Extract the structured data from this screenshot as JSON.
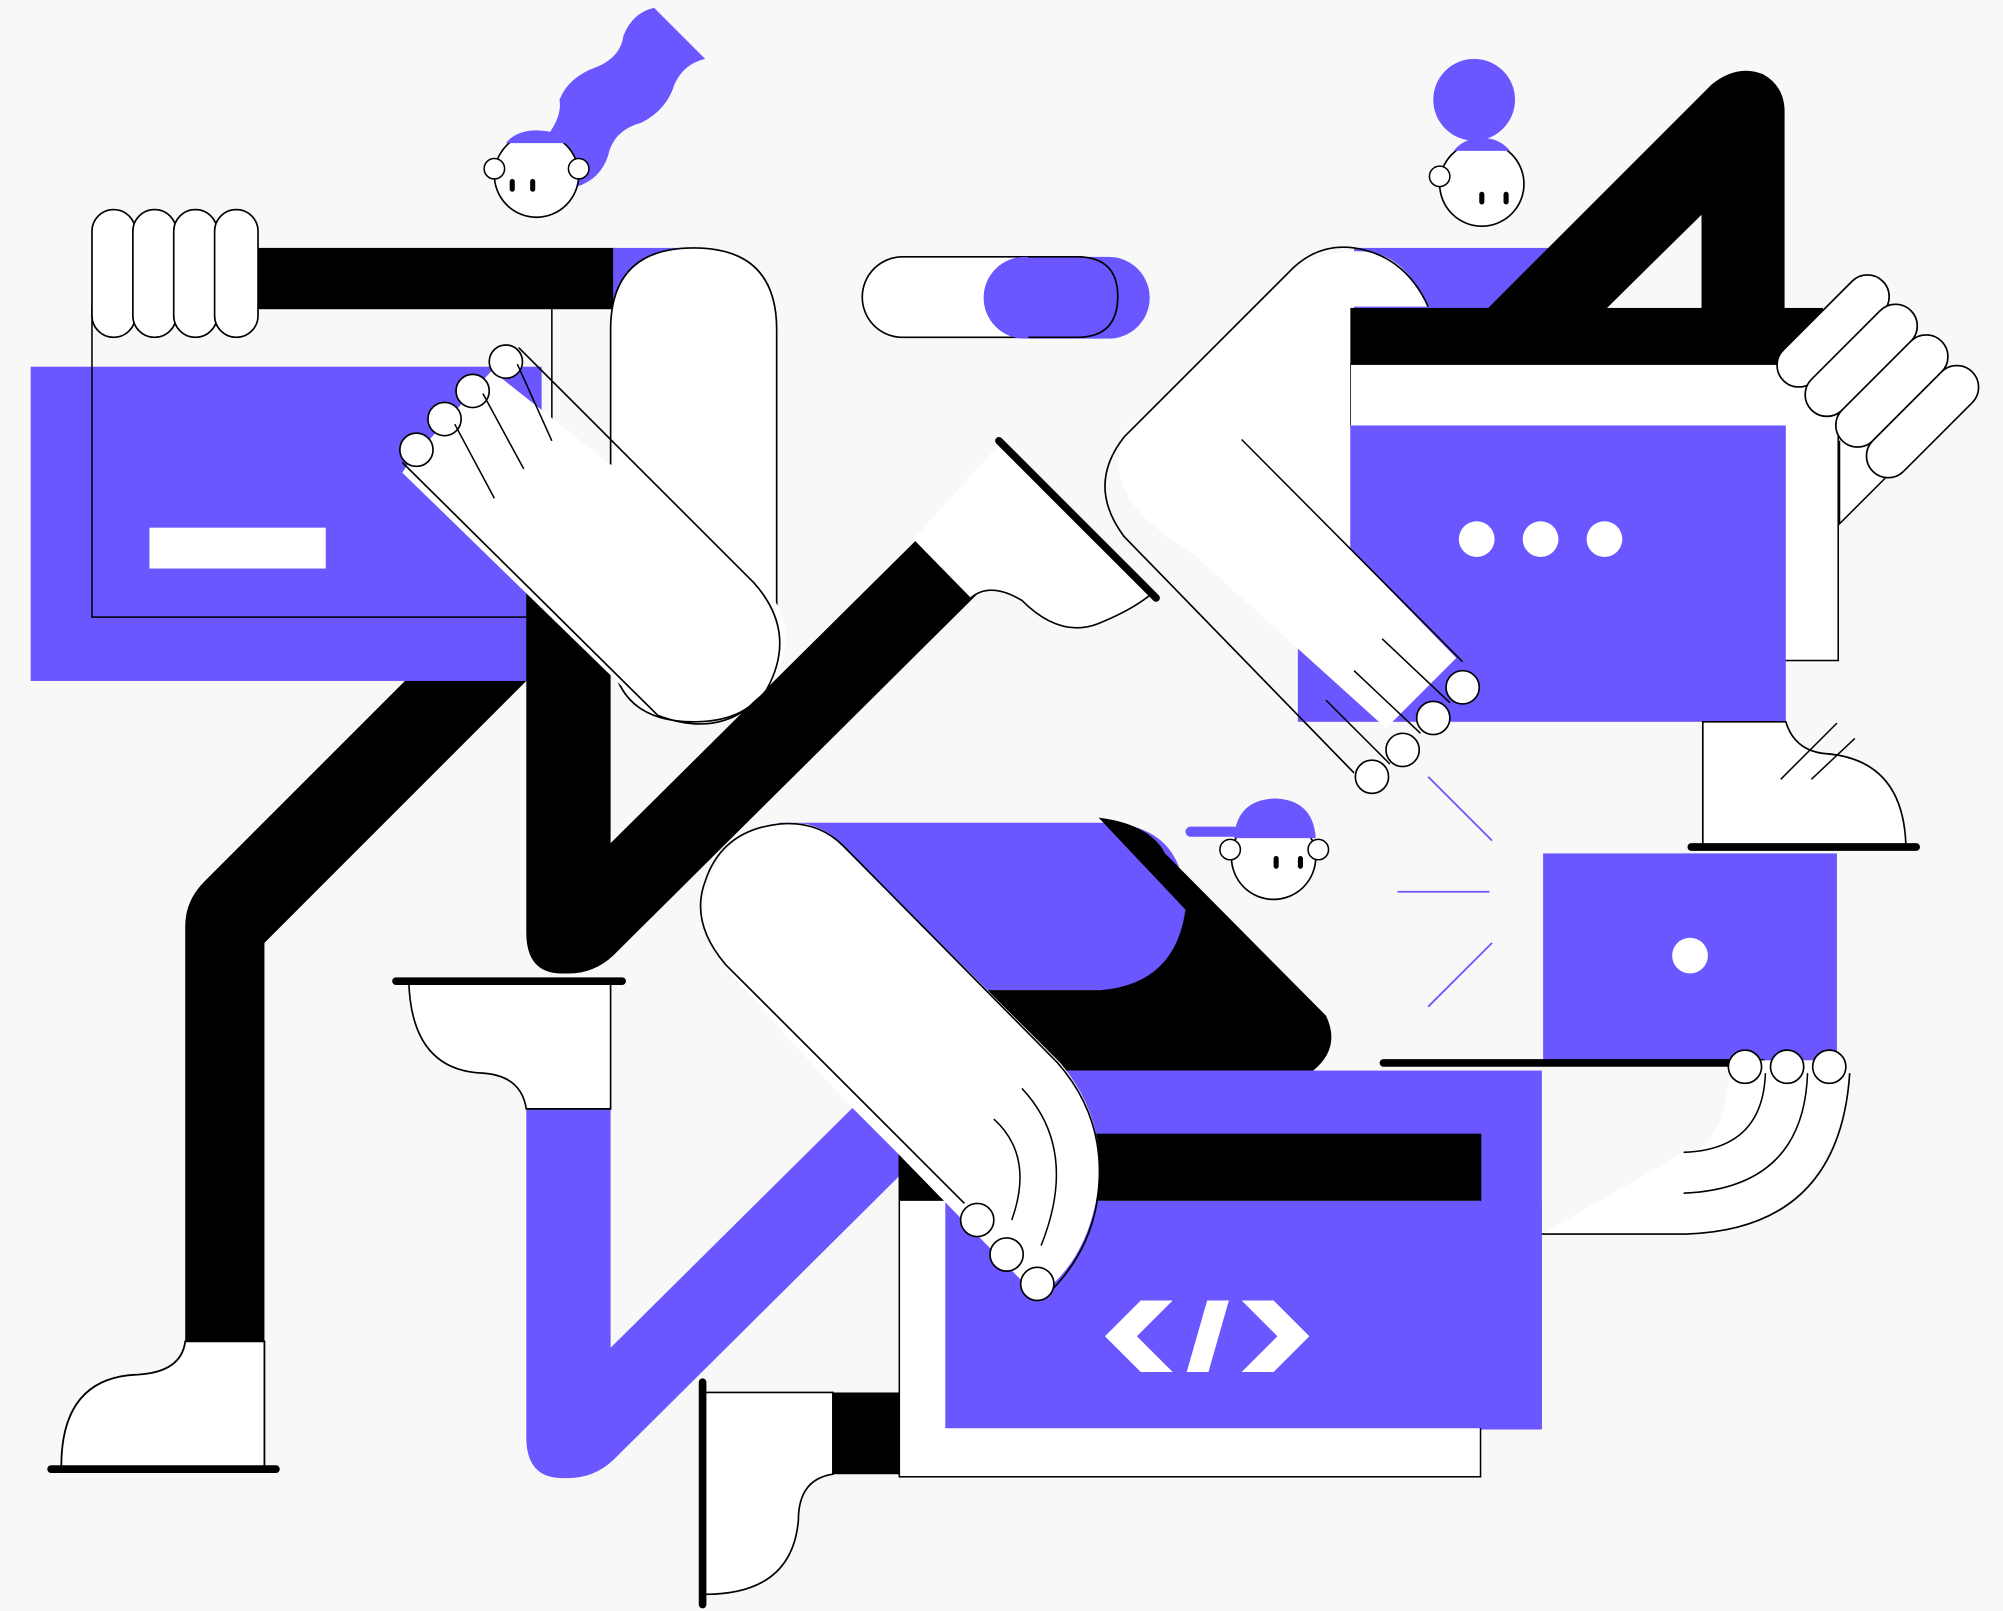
{
  "colors": {
    "background": "#f8f8f8",
    "accent": "#6a57ff",
    "ink": "#000000",
    "paper": "#ffffff"
  },
  "scene": {
    "description_icons": [
      "code-window-icon",
      "dots-window-icon",
      "dash-window-icon",
      "laptop-icon",
      "toggle-switch-icon"
    ]
  },
  "code_window": {
    "code_symbol": "</>"
  },
  "toggle": {
    "state": "on"
  }
}
